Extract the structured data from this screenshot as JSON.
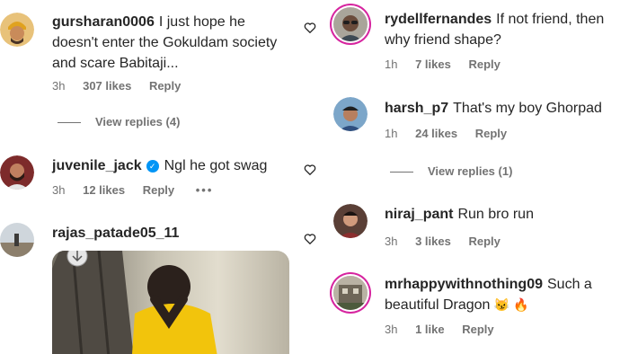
{
  "left_column": {
    "comments": [
      {
        "username": "gursharan0006",
        "text": "I just hope he doesn't enter the Gokuldam society and scare Babitaji...",
        "time": "3h",
        "likes": "307 likes",
        "reply": "Reply",
        "view_replies": "View replies (4)",
        "avatar_icon": "avatar-turban-icon"
      },
      {
        "username": "juvenile_jack",
        "verified": true,
        "text": "Ngl he got swag",
        "time": "3h",
        "likes": "12 likes",
        "reply": "Reply",
        "more": "•••",
        "avatar_icon": "avatar-bearded-man-icon"
      },
      {
        "username": "rajas_patade05_11",
        "text": "",
        "avatar_icon": "avatar-landscape-icon",
        "image_icon": "photo-man-yellow-shirt-behind-tree"
      }
    ]
  },
  "right_column": {
    "comments": [
      {
        "username": "rydellfernandes",
        "text": "If not friend, then why friend shape?",
        "time": "1h",
        "likes": "7 likes",
        "reply": "Reply",
        "has_story_ring": true
      },
      {
        "username": "harsh_p7",
        "text": "That's my boy Ghorpad",
        "time": "1h",
        "likes": "24 likes",
        "reply": "Reply",
        "view_replies": "View replies (1)"
      },
      {
        "username": "niraj_pant",
        "text": "Run bro run",
        "time": "3h",
        "likes": "3 likes",
        "reply": "Reply"
      },
      {
        "username": "mrhappywithnothing09",
        "text": "Such a beautiful Dragon",
        "emojis": "😼 🔥",
        "time": "3h",
        "likes": "1 like",
        "reply": "Reply",
        "has_story_ring": true
      }
    ]
  },
  "colors": {
    "text": "#262626",
    "meta": "#737373",
    "verified": "#0095f6",
    "story_ring": "#d6249f"
  }
}
